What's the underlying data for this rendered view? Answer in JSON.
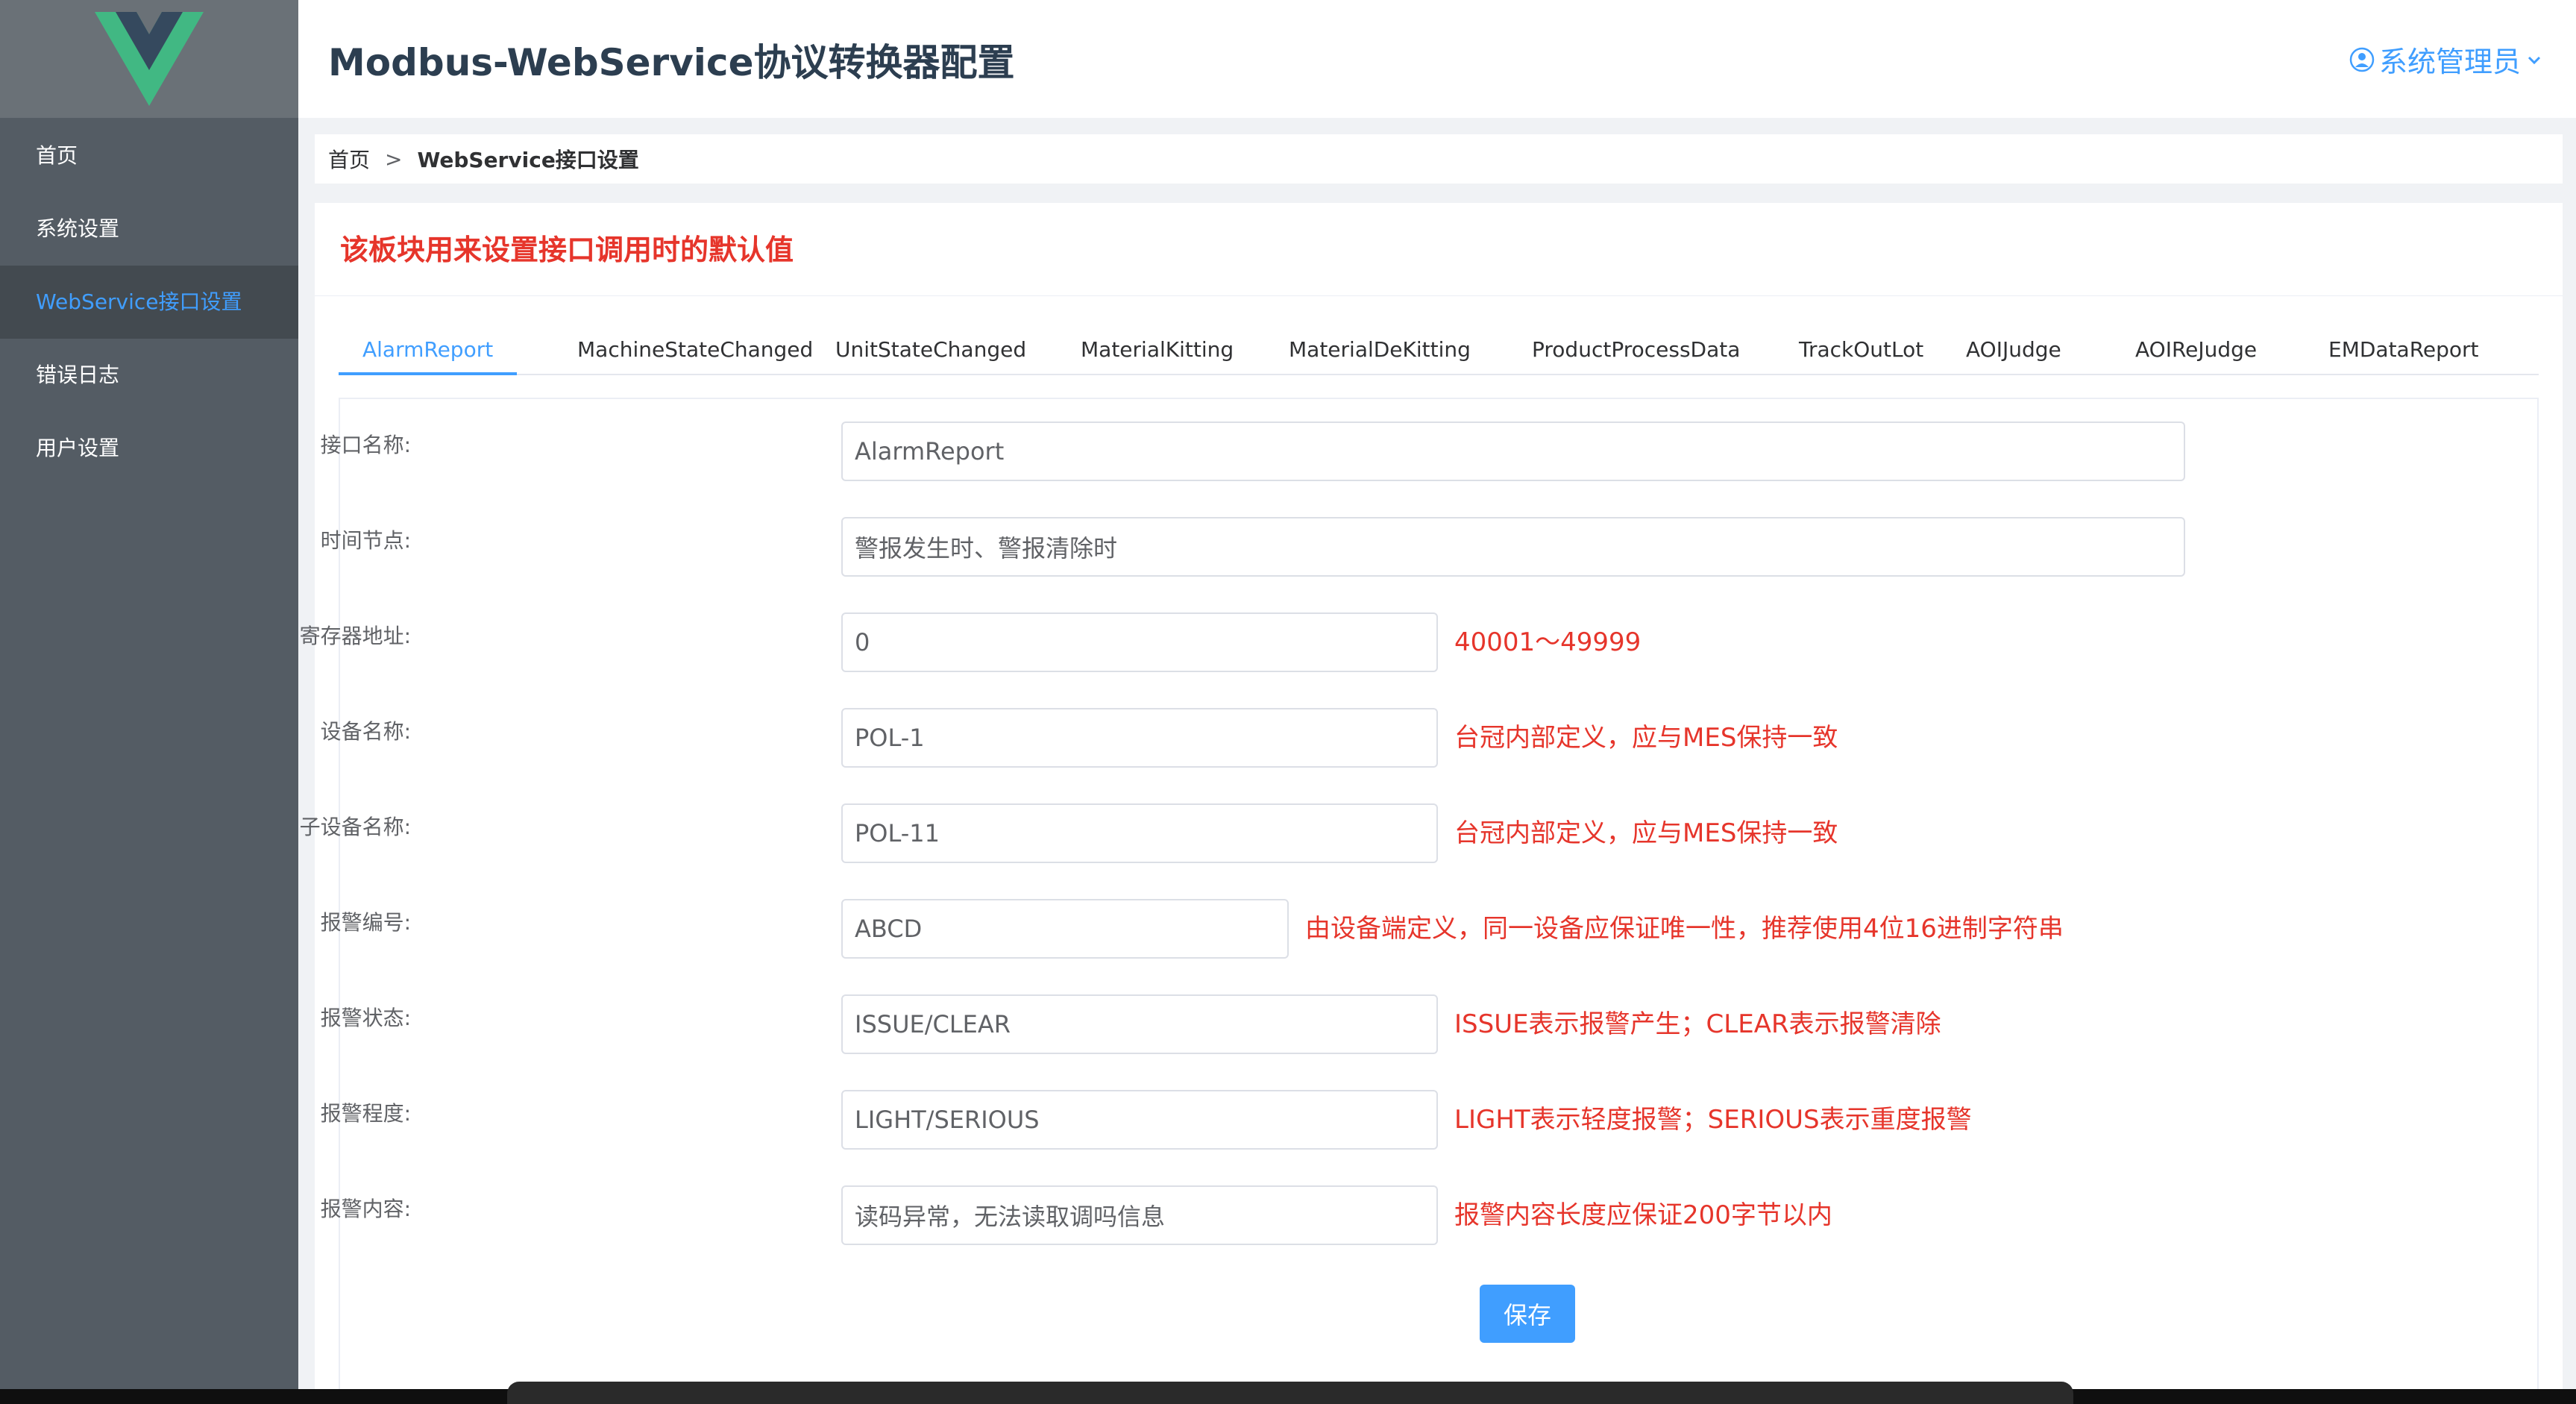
{
  "header": {
    "title": "Modbus-WebService协议转换器配置",
    "user_label": "系统管理员"
  },
  "sidebar": {
    "items": [
      {
        "label": "首页"
      },
      {
        "label": "系统设置"
      },
      {
        "label": "WebService接口设置",
        "active": true
      },
      {
        "label": "错误日志"
      },
      {
        "label": "用户设置"
      }
    ]
  },
  "breadcrumb": {
    "home": "首页",
    "separator": ">",
    "current": "WebService接口设置"
  },
  "notice": "该板块用来设置接口调用时的默认值",
  "tabs": [
    "AlarmReport",
    "MachineStateChanged",
    "UnitStateChanged",
    "MaterialKitting",
    "MaterialDeKitting",
    "ProductProcessData",
    "TrackOutLot",
    "AOIJudge",
    "AOIReJudge",
    "EMDataReport"
  ],
  "active_tab": "AlarmReport",
  "form": {
    "interface_name": {
      "label": "接口名称:",
      "value": "AlarmReport"
    },
    "time_node": {
      "label": "时间节点:",
      "value": "警报发生时、警报清除时"
    },
    "register_address": {
      "label": "寄存器地址:",
      "value": "0",
      "hint": "40001～49999"
    },
    "device_name": {
      "label": "设备名称:",
      "value": "POL-1",
      "hint": "台冠内部定义，应与MES保持一致"
    },
    "sub_device_name": {
      "label": "子设备名称:",
      "value": "POL-11",
      "hint": "台冠内部定义，应与MES保持一致"
    },
    "alarm_code": {
      "label": "报警编号:",
      "value": "ABCD",
      "hint": "由设备端定义，同一设备应保证唯一性，推荐使用4位16进制字符串"
    },
    "alarm_state": {
      "label": "报警状态:",
      "value": "ISSUE/CLEAR",
      "hint": "ISSUE表示报警产生；CLEAR表示报警清除"
    },
    "alarm_level": {
      "label": "报警程度:",
      "value": "LIGHT/SERIOUS",
      "hint": "LIGHT表示轻度报警；SERIOUS表示重度报警"
    },
    "alarm_content": {
      "label": "报警内容:",
      "value": "读码异常，无法读取调吗信息",
      "hint": "报警内容长度应保证200字节以内"
    },
    "save_label": "保存"
  },
  "colors": {
    "sidebar_bg": "#545c64",
    "accent": "#409eff",
    "hint_red": "#e6352b",
    "logo_green": "#41b883",
    "logo_dark": "#35495e"
  },
  "icons": {
    "logo": "vue-logo-icon",
    "user": "user-circle-icon",
    "dropdown": "chevron-down-icon"
  }
}
